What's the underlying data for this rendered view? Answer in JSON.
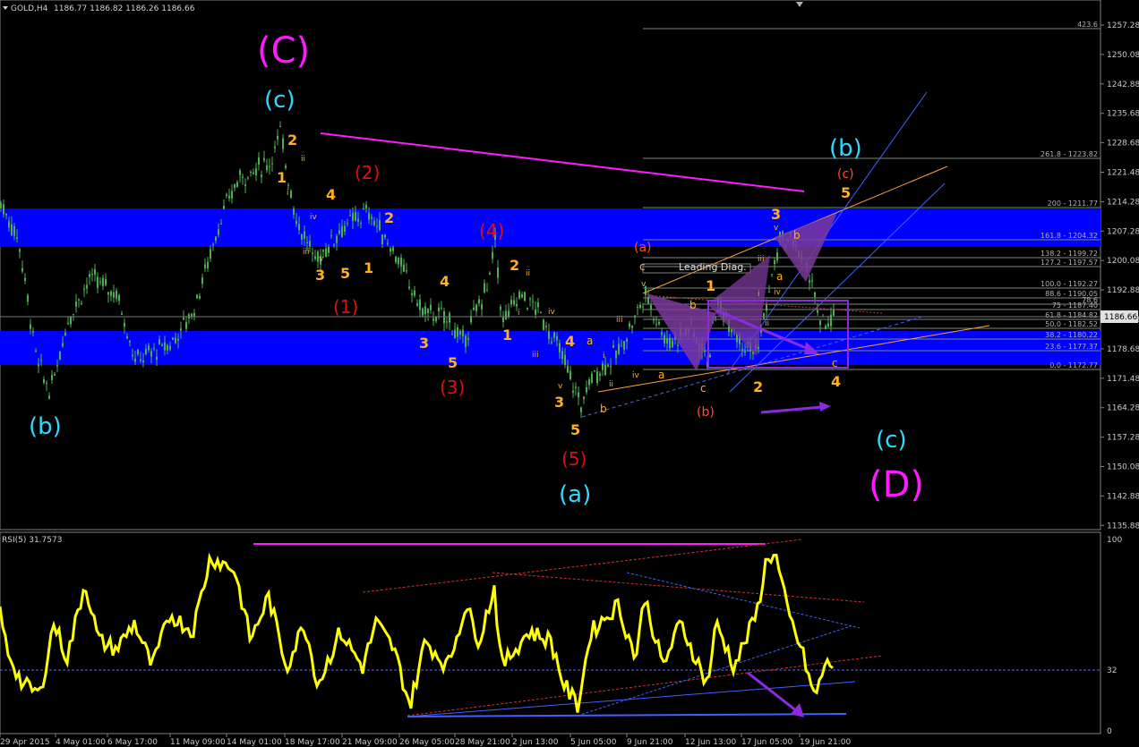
{
  "header": {
    "symbol": "GOLD,H4",
    "ohlc": "1186.77 1186.82 1186.26 1186.66"
  },
  "rsi_header": "RSI(5) 31.7573",
  "colors": {
    "background": "#000000",
    "candles": "#4caf50",
    "zone": "#0000ff",
    "rsi_line": "#ffff00",
    "magenta": "#ff1aff",
    "cyan": "#30d8ff",
    "orange": "#ffb020",
    "red": "#e01010",
    "purple": "#8a2be2"
  },
  "axis": {
    "price_ticks": [
      "1257.28",
      "1250.08",
      "1242.88",
      "1235.68",
      "1228.68",
      "1221.48",
      "1214.28",
      "1207.28",
      "1200.08",
      "1192.88",
      "1185.68",
      "1178.68",
      "1171.48",
      "1164.28",
      "1157.28",
      "1150.08",
      "1142.88",
      "1135.88"
    ],
    "current_price": "1186.66",
    "time_ticks": [
      "29 Apr 2015",
      "4 May 01:00",
      "6 May 17:00",
      "11 May 09:00",
      "14 May 01:00",
      "18 May 17:00",
      "21 May 09:00",
      "26 May 05:00",
      "28 May 21:00",
      "2 Jun 13:00",
      "5 Jun 05:00",
      "9 Jun 21:00",
      "12 Jun 13:00",
      "17 Jun 05:00",
      "19 Jun 21:00"
    ],
    "rsi_ticks": [
      "100",
      "32",
      "0"
    ]
  },
  "fib_levels": [
    "423.6",
    "261.8 - 1223.82",
    "200 - 1211.77",
    "161.8 - 1204.32",
    "138.2 - 1199.72",
    "127.2 - 1197.57",
    "100.0 - 1192.27",
    "88.6 - 1190.05",
    "78.6",
    "75 - 1187.40",
    "61.8 - 1184.82",
    "50.0 - 1182.52",
    "38.2 - 1180.22",
    "23.6 - 1177.37",
    "0.0 - 1172.77"
  ],
  "labels": {
    "C_big": "(C)",
    "D_big": "(D)",
    "c_top": "(c)",
    "b_left": "(b)",
    "a_bottom": "(a)",
    "b_right": "(b)",
    "c_right": "(c)",
    "leading_diag": "Leading Diag.",
    "red1": "(1)",
    "red2": "(2)",
    "red3": "(3)",
    "red4": "(4)",
    "red5": "(5)",
    "a_or": "(a)",
    "b_or": "(b)",
    "c_or": "(c)",
    "o1": "1",
    "o2": "2",
    "o3": "3",
    "o4": "4",
    "o5": "5",
    "ri": "i",
    "rii": "ii",
    "riii": "iii",
    "riv": "iv",
    "rv": "v",
    "la": "a",
    "lb": "b",
    "lc": "c"
  },
  "chart_data": [
    {
      "type": "line",
      "title": "GOLD,H4",
      "description_series": "Gold H4 candlestick price (approximate swing points)",
      "series": [
        {
          "name": "",
          "x": [
            "29 Apr 2015",
            "4 May 01:00",
            "6 May 17:00",
            "11 May 09:00",
            "14 May 01:00",
            "18 May 17:00",
            "21 May 09:00",
            "26 May 05:00",
            "28 May 21:00",
            "2 Jun 13:00",
            "5 Jun 05:00",
            "9 Jun 21:00",
            "12 Jun 13:00",
            "17 Jun 05:00",
            "19 Jun 21:00"
          ],
          "values": [
            1210,
            1172,
            1188,
            1186,
            1228,
            1206,
            1205,
            1182,
            1195,
            1187,
            1165,
            1192,
            1178,
            1205,
            1186
          ]
        }
      ],
      "ylim": [
        1135.88,
        1257.28
      ]
    },
    {
      "type": "line",
      "title": "RSI(5) 31.7573",
      "series": [
        {
          "name": "",
          "x": [
            "29 Apr 2015",
            "4 May 01:00",
            "6 May 17:00",
            "11 May 09:00",
            "14 May 01:00",
            "18 May 17:00",
            "21 May 09:00",
            "26 May 05:00",
            "28 May 21:00",
            "2 Jun 13:00",
            "5 Jun 05:00",
            "9 Jun 21:00",
            "12 Jun 13:00",
            "17 Jun 05:00",
            "19 Jun 21:00"
          ],
          "values": [
            60,
            10,
            75,
            50,
            92,
            40,
            55,
            8,
            70,
            45,
            8,
            70,
            25,
            97,
            32
          ]
        }
      ],
      "ylim": [
        0,
        100
      ]
    }
  ]
}
